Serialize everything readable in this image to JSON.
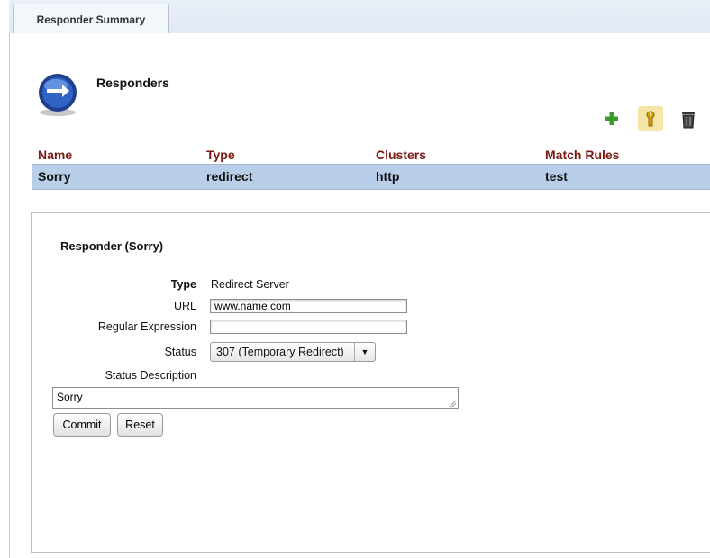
{
  "tab": {
    "label": "Responder Summary"
  },
  "header": {
    "title": "Responders"
  },
  "toolbar": {
    "add_icon": "plus-icon",
    "edit_icon": "wrench-icon",
    "delete_icon": "trash-icon",
    "colors": {
      "add": "#3a9a2c",
      "edit": "#d9a400",
      "delete": "#333333"
    }
  },
  "table": {
    "columns": [
      "Name",
      "Type",
      "Clusters",
      "Match Rules"
    ],
    "rows": [
      [
        "Sorry",
        "redirect",
        "http",
        "test"
      ]
    ],
    "header_color": "#7a1a12",
    "selected_color": "#b9cee8"
  },
  "detail": {
    "title": "Responder (Sorry)",
    "type_label": "Type",
    "type_value": "Redirect Server",
    "url_label": "URL",
    "url_value": "www.name.com",
    "regex_label": "Regular Expression",
    "regex_value": "",
    "status_label": "Status",
    "status_value": "307 (Temporary Redirect)",
    "status_desc_label": "Status Description",
    "status_desc_value": "Sorry",
    "commit_label": "Commit",
    "reset_label": "Reset"
  }
}
